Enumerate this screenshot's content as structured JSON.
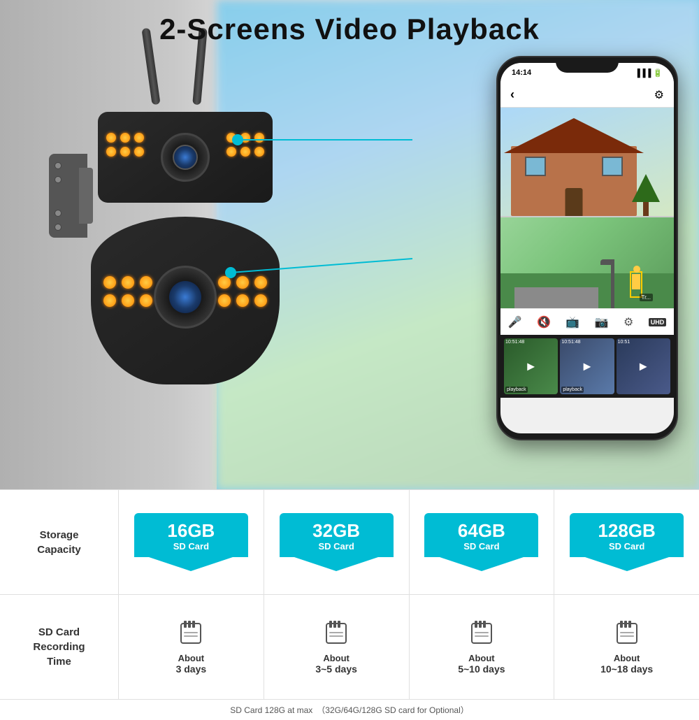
{
  "page": {
    "title": "2-Screens Video Playback"
  },
  "hero": {
    "title": "2-Screens Video Playback"
  },
  "phone": {
    "time": "14:14",
    "signal_icons": "▐▐▐ 📶 🔋",
    "back_label": "‹",
    "settings_label": "⚙",
    "uhd_label": "UHD"
  },
  "storage": {
    "label": "Storage\nCapacity",
    "options": [
      {
        "size": "16GB",
        "card": "SD Card",
        "color": "#00bcd4"
      },
      {
        "size": "32GB",
        "card": "SD Card",
        "color": "#00bcd4"
      },
      {
        "size": "64GB",
        "card": "SD Card",
        "color": "#00bcd4"
      },
      {
        "size": "128GB",
        "card": "SD Card",
        "color": "#00bcd4"
      }
    ]
  },
  "recording": {
    "label": "SD Card\nRecording\nTime",
    "times": [
      {
        "about": "About",
        "days": "3 days"
      },
      {
        "about": "About",
        "days": "3~5 days"
      },
      {
        "about": "About",
        "days": "5~10 days"
      },
      {
        "about": "About",
        "days": "10~18 days"
      }
    ]
  },
  "footer": {
    "note": "SD Card 128G at max　（32G/64G/128G SD card for Optional）"
  },
  "thumbnails": [
    {
      "time": "10:51:48",
      "label": "playback"
    },
    {
      "time": "10:51:48",
      "label": "playback"
    },
    {
      "time": "10:51",
      "label": ""
    }
  ]
}
